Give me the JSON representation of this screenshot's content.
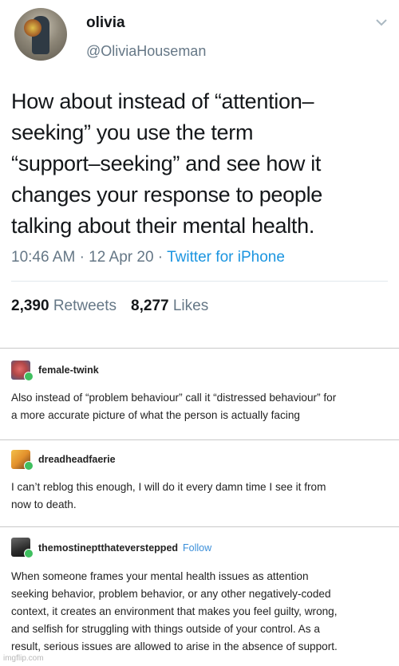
{
  "tweet": {
    "display_name": "olivia",
    "handle": "@OliviaHouseman",
    "text_lines": [
      "How about instead of “attention–",
      "seeking” you use the term",
      "“support–seeking” and see how it",
      "changes your response to people",
      "talking about their mental health."
    ],
    "time": "10:46 AM",
    "date": "12 Apr 20",
    "source": "Twitter for iPhone",
    "retweets_count": "2,390",
    "retweets_label": "Retweets",
    "likes_count": "8,277",
    "likes_label": "Likes"
  },
  "posts": [
    {
      "username": "female-twink",
      "lines": [
        "Also instead of “problem behaviour” call it “distressed behaviour” for",
        "a more accurate picture of what the person is actually facing"
      ]
    },
    {
      "username": "dreadheadfaerie",
      "lines": [
        "I can’t reblog this enough, I will do it every damn time I see it from",
        "now to death."
      ]
    },
    {
      "username": "themostineptthateverstepped",
      "follow_label": "Follow",
      "lines": [
        "When someone frames your mental health issues as attention",
        "seeking behavior, problem behavior, or any other negatively-coded",
        "context, it creates an environment that makes you feel guilty, wrong,",
        "and selfish for struggling with things outside of your control. As a",
        "result, serious issues are allowed to arise in the absence of support."
      ]
    }
  ],
  "watermark": "imgflip.com",
  "colors": {
    "twitter_gray": "#657786",
    "twitter_blue": "#1b95e0",
    "tumblr_follow": "#3b8fd9",
    "plus_badge": "#3fbf5f"
  }
}
